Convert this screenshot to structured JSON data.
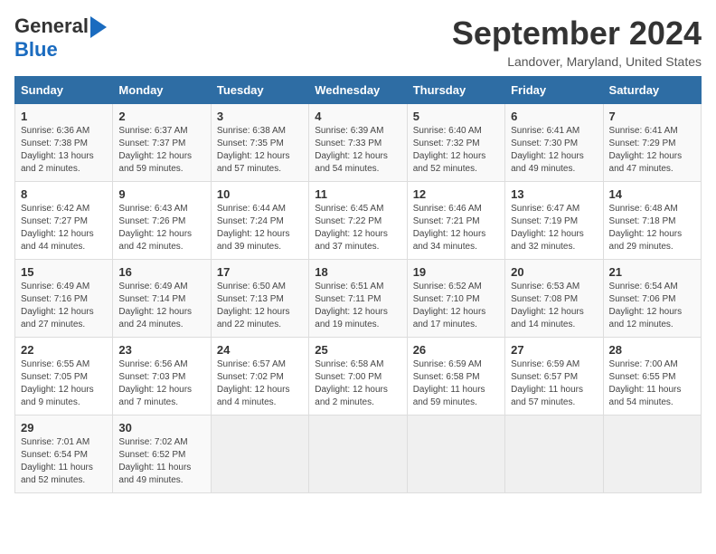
{
  "logo": {
    "part1": "General",
    "part2": "Blue"
  },
  "calendar": {
    "title": "September 2024",
    "subtitle": "Landover, Maryland, United States",
    "days_header": [
      "Sunday",
      "Monday",
      "Tuesday",
      "Wednesday",
      "Thursday",
      "Friday",
      "Saturday"
    ],
    "weeks": [
      [
        {
          "day": "1",
          "sunrise": "Sunrise: 6:36 AM",
          "sunset": "Sunset: 7:38 PM",
          "daylight": "Daylight: 13 hours and 2 minutes."
        },
        {
          "day": "2",
          "sunrise": "Sunrise: 6:37 AM",
          "sunset": "Sunset: 7:37 PM",
          "daylight": "Daylight: 12 hours and 59 minutes."
        },
        {
          "day": "3",
          "sunrise": "Sunrise: 6:38 AM",
          "sunset": "Sunset: 7:35 PM",
          "daylight": "Daylight: 12 hours and 57 minutes."
        },
        {
          "day": "4",
          "sunrise": "Sunrise: 6:39 AM",
          "sunset": "Sunset: 7:33 PM",
          "daylight": "Daylight: 12 hours and 54 minutes."
        },
        {
          "day": "5",
          "sunrise": "Sunrise: 6:40 AM",
          "sunset": "Sunset: 7:32 PM",
          "daylight": "Daylight: 12 hours and 52 minutes."
        },
        {
          "day": "6",
          "sunrise": "Sunrise: 6:41 AM",
          "sunset": "Sunset: 7:30 PM",
          "daylight": "Daylight: 12 hours and 49 minutes."
        },
        {
          "day": "7",
          "sunrise": "Sunrise: 6:41 AM",
          "sunset": "Sunset: 7:29 PM",
          "daylight": "Daylight: 12 hours and 47 minutes."
        }
      ],
      [
        {
          "day": "8",
          "sunrise": "Sunrise: 6:42 AM",
          "sunset": "Sunset: 7:27 PM",
          "daylight": "Daylight: 12 hours and 44 minutes."
        },
        {
          "day": "9",
          "sunrise": "Sunrise: 6:43 AM",
          "sunset": "Sunset: 7:26 PM",
          "daylight": "Daylight: 12 hours and 42 minutes."
        },
        {
          "day": "10",
          "sunrise": "Sunrise: 6:44 AM",
          "sunset": "Sunset: 7:24 PM",
          "daylight": "Daylight: 12 hours and 39 minutes."
        },
        {
          "day": "11",
          "sunrise": "Sunrise: 6:45 AM",
          "sunset": "Sunset: 7:22 PM",
          "daylight": "Daylight: 12 hours and 37 minutes."
        },
        {
          "day": "12",
          "sunrise": "Sunrise: 6:46 AM",
          "sunset": "Sunset: 7:21 PM",
          "daylight": "Daylight: 12 hours and 34 minutes."
        },
        {
          "day": "13",
          "sunrise": "Sunrise: 6:47 AM",
          "sunset": "Sunset: 7:19 PM",
          "daylight": "Daylight: 12 hours and 32 minutes."
        },
        {
          "day": "14",
          "sunrise": "Sunrise: 6:48 AM",
          "sunset": "Sunset: 7:18 PM",
          "daylight": "Daylight: 12 hours and 29 minutes."
        }
      ],
      [
        {
          "day": "15",
          "sunrise": "Sunrise: 6:49 AM",
          "sunset": "Sunset: 7:16 PM",
          "daylight": "Daylight: 12 hours and 27 minutes."
        },
        {
          "day": "16",
          "sunrise": "Sunrise: 6:49 AM",
          "sunset": "Sunset: 7:14 PM",
          "daylight": "Daylight: 12 hours and 24 minutes."
        },
        {
          "day": "17",
          "sunrise": "Sunrise: 6:50 AM",
          "sunset": "Sunset: 7:13 PM",
          "daylight": "Daylight: 12 hours and 22 minutes."
        },
        {
          "day": "18",
          "sunrise": "Sunrise: 6:51 AM",
          "sunset": "Sunset: 7:11 PM",
          "daylight": "Daylight: 12 hours and 19 minutes."
        },
        {
          "day": "19",
          "sunrise": "Sunrise: 6:52 AM",
          "sunset": "Sunset: 7:10 PM",
          "daylight": "Daylight: 12 hours and 17 minutes."
        },
        {
          "day": "20",
          "sunrise": "Sunrise: 6:53 AM",
          "sunset": "Sunset: 7:08 PM",
          "daylight": "Daylight: 12 hours and 14 minutes."
        },
        {
          "day": "21",
          "sunrise": "Sunrise: 6:54 AM",
          "sunset": "Sunset: 7:06 PM",
          "daylight": "Daylight: 12 hours and 12 minutes."
        }
      ],
      [
        {
          "day": "22",
          "sunrise": "Sunrise: 6:55 AM",
          "sunset": "Sunset: 7:05 PM",
          "daylight": "Daylight: 12 hours and 9 minutes."
        },
        {
          "day": "23",
          "sunrise": "Sunrise: 6:56 AM",
          "sunset": "Sunset: 7:03 PM",
          "daylight": "Daylight: 12 hours and 7 minutes."
        },
        {
          "day": "24",
          "sunrise": "Sunrise: 6:57 AM",
          "sunset": "Sunset: 7:02 PM",
          "daylight": "Daylight: 12 hours and 4 minutes."
        },
        {
          "day": "25",
          "sunrise": "Sunrise: 6:58 AM",
          "sunset": "Sunset: 7:00 PM",
          "daylight": "Daylight: 12 hours and 2 minutes."
        },
        {
          "day": "26",
          "sunrise": "Sunrise: 6:59 AM",
          "sunset": "Sunset: 6:58 PM",
          "daylight": "Daylight: 11 hours and 59 minutes."
        },
        {
          "day": "27",
          "sunrise": "Sunrise: 6:59 AM",
          "sunset": "Sunset: 6:57 PM",
          "daylight": "Daylight: 11 hours and 57 minutes."
        },
        {
          "day": "28",
          "sunrise": "Sunrise: 7:00 AM",
          "sunset": "Sunset: 6:55 PM",
          "daylight": "Daylight: 11 hours and 54 minutes."
        }
      ],
      [
        {
          "day": "29",
          "sunrise": "Sunrise: 7:01 AM",
          "sunset": "Sunset: 6:54 PM",
          "daylight": "Daylight: 11 hours and 52 minutes."
        },
        {
          "day": "30",
          "sunrise": "Sunrise: 7:02 AM",
          "sunset": "Sunset: 6:52 PM",
          "daylight": "Daylight: 11 hours and 49 minutes."
        },
        null,
        null,
        null,
        null,
        null
      ]
    ]
  }
}
